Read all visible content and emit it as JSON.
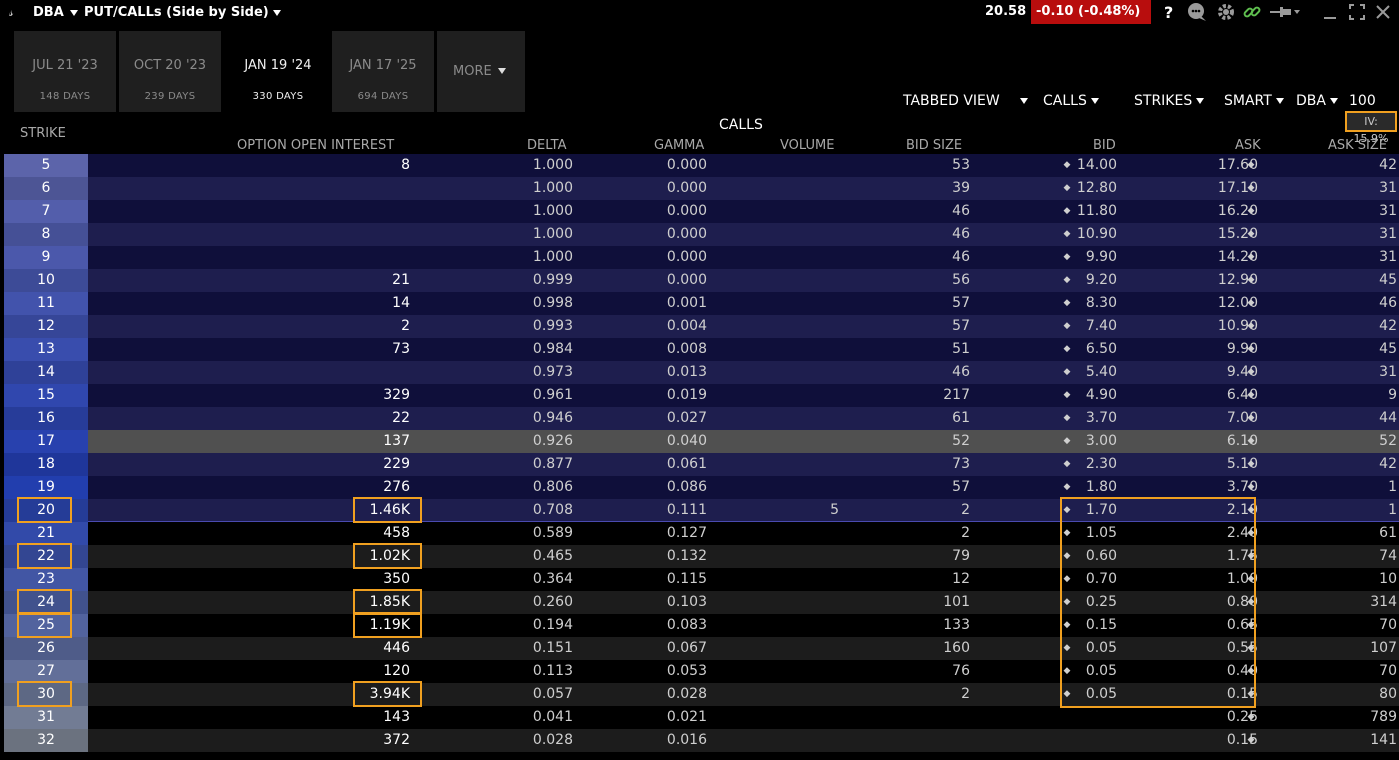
{
  "window": {
    "link_glyph": "𝓈",
    "symbol": "DBA",
    "layout_title": "PUT/CALLs (Side by Side)",
    "last_price": "20.58",
    "change": "-0.10 (-0.48%)",
    "icons": [
      "help-icon",
      "chat-icon",
      "gear-icon",
      "link-icon",
      "pin-icon",
      "minimize-icon",
      "maximize-icon",
      "close-icon"
    ]
  },
  "expiries": [
    {
      "date": "JUL 21 '23",
      "days": "148 DAYS",
      "active": false
    },
    {
      "date": "OCT 20 '23",
      "days": "239 DAYS",
      "active": false
    },
    {
      "date": "JAN 19 '24",
      "days": "330 DAYS",
      "active": true
    },
    {
      "date": "JAN 17 '25",
      "days": "694 DAYS",
      "active": false
    }
  ],
  "more_label": "MORE",
  "toolbar": {
    "tabbed_view": "TABBED VIEW",
    "calls": "CALLS",
    "strikes": "STRIKES",
    "smart": "SMART",
    "underlying": "DBA",
    "multiplier": "100"
  },
  "table_title": "CALLS",
  "iv_badge": "IV: 15.9%",
  "headers": {
    "strike": "STRIKE",
    "oi": "OPTION OPEN INTEREST",
    "delta": "DELTA",
    "gamma": "GAMMA",
    "volume": "VOLUME",
    "bid_size": "BID SIZE",
    "bid": "BID",
    "ask": "ASK",
    "ask_size": "ASK SIZE"
  },
  "rows": [
    {
      "strike": "5",
      "oi": "8",
      "delta": "1.000",
      "gamma": "0.000",
      "volume": "",
      "bid_size": "53",
      "bid": "14.00",
      "ask": "17.60",
      "ask_size": "42"
    },
    {
      "strike": "6",
      "oi": "",
      "delta": "1.000",
      "gamma": "0.000",
      "volume": "",
      "bid_size": "39",
      "bid": "12.80",
      "ask": "17.10",
      "ask_size": "31"
    },
    {
      "strike": "7",
      "oi": "",
      "delta": "1.000",
      "gamma": "0.000",
      "volume": "",
      "bid_size": "46",
      "bid": "11.80",
      "ask": "16.20",
      "ask_size": "31"
    },
    {
      "strike": "8",
      "oi": "",
      "delta": "1.000",
      "gamma": "0.000",
      "volume": "",
      "bid_size": "46",
      "bid": "10.90",
      "ask": "15.20",
      "ask_size": "31"
    },
    {
      "strike": "9",
      "oi": "",
      "delta": "1.000",
      "gamma": "0.000",
      "volume": "",
      "bid_size": "46",
      "bid": "9.90",
      "ask": "14.20",
      "ask_size": "31"
    },
    {
      "strike": "10",
      "oi": "21",
      "delta": "0.999",
      "gamma": "0.000",
      "volume": "",
      "bid_size": "56",
      "bid": "9.20",
      "ask": "12.90",
      "ask_size": "45"
    },
    {
      "strike": "11",
      "oi": "14",
      "delta": "0.998",
      "gamma": "0.001",
      "volume": "",
      "bid_size": "57",
      "bid": "8.30",
      "ask": "12.00",
      "ask_size": "46"
    },
    {
      "strike": "12",
      "oi": "2",
      "delta": "0.993",
      "gamma": "0.004",
      "volume": "",
      "bid_size": "57",
      "bid": "7.40",
      "ask": "10.90",
      "ask_size": "42"
    },
    {
      "strike": "13",
      "oi": "73",
      "delta": "0.984",
      "gamma": "0.008",
      "volume": "",
      "bid_size": "51",
      "bid": "6.50",
      "ask": "9.90",
      "ask_size": "45"
    },
    {
      "strike": "14",
      "oi": "",
      "delta": "0.973",
      "gamma": "0.013",
      "volume": "",
      "bid_size": "46",
      "bid": "5.40",
      "ask": "9.40",
      "ask_size": "31"
    },
    {
      "strike": "15",
      "oi": "329",
      "delta": "0.961",
      "gamma": "0.019",
      "volume": "",
      "bid_size": "217",
      "bid": "4.90",
      "ask": "6.40",
      "ask_size": "9"
    },
    {
      "strike": "16",
      "oi": "22",
      "delta": "0.946",
      "gamma": "0.027",
      "volume": "",
      "bid_size": "61",
      "bid": "3.70",
      "ask": "7.00",
      "ask_size": "44"
    },
    {
      "strike": "17",
      "oi": "137",
      "delta": "0.926",
      "gamma": "0.040",
      "volume": "",
      "bid_size": "52",
      "bid": "3.00",
      "ask": "6.10",
      "ask_size": "52"
    },
    {
      "strike": "18",
      "oi": "229",
      "delta": "0.877",
      "gamma": "0.061",
      "volume": "",
      "bid_size": "73",
      "bid": "2.30",
      "ask": "5.10",
      "ask_size": "42"
    },
    {
      "strike": "19",
      "oi": "276",
      "delta": "0.806",
      "gamma": "0.086",
      "volume": "",
      "bid_size": "57",
      "bid": "1.80",
      "ask": "3.70",
      "ask_size": "1"
    },
    {
      "strike": "20",
      "oi": "1.46K",
      "delta": "0.708",
      "gamma": "0.111",
      "volume": "5",
      "bid_size": "2",
      "bid": "1.70",
      "ask": "2.10",
      "ask_size": "1"
    },
    {
      "strike": "21",
      "oi": "458",
      "delta": "0.589",
      "gamma": "0.127",
      "volume": "",
      "bid_size": "2",
      "bid": "1.05",
      "ask": "2.40",
      "ask_size": "61"
    },
    {
      "strike": "22",
      "oi": "1.02K",
      "delta": "0.465",
      "gamma": "0.132",
      "volume": "",
      "bid_size": "79",
      "bid": "0.60",
      "ask": "1.75",
      "ask_size": "74"
    },
    {
      "strike": "23",
      "oi": "350",
      "delta": "0.364",
      "gamma": "0.115",
      "volume": "",
      "bid_size": "12",
      "bid": "0.70",
      "ask": "1.00",
      "ask_size": "10"
    },
    {
      "strike": "24",
      "oi": "1.85K",
      "delta": "0.260",
      "gamma": "0.103",
      "volume": "",
      "bid_size": "101",
      "bid": "0.25",
      "ask": "0.80",
      "ask_size": "314"
    },
    {
      "strike": "25",
      "oi": "1.19K",
      "delta": "0.194",
      "gamma": "0.083",
      "volume": "",
      "bid_size": "133",
      "bid": "0.15",
      "ask": "0.65",
      "ask_size": "70"
    },
    {
      "strike": "26",
      "oi": "446",
      "delta": "0.151",
      "gamma": "0.067",
      "volume": "",
      "bid_size": "160",
      "bid": "0.05",
      "ask": "0.55",
      "ask_size": "107"
    },
    {
      "strike": "27",
      "oi": "120",
      "delta": "0.113",
      "gamma": "0.053",
      "volume": "",
      "bid_size": "76",
      "bid": "0.05",
      "ask": "0.40",
      "ask_size": "70"
    },
    {
      "strike": "30",
      "oi": "3.94K",
      "delta": "0.057",
      "gamma": "0.028",
      "volume": "",
      "bid_size": "2",
      "bid": "0.05",
      "ask": "0.15",
      "ask_size": "80"
    },
    {
      "strike": "31",
      "oi": "143",
      "delta": "0.041",
      "gamma": "0.021",
      "volume": "",
      "bid_size": "",
      "bid": "",
      "ask": "0.25",
      "ask_size": "789"
    },
    {
      "strike": "32",
      "oi": "372",
      "delta": "0.028",
      "gamma": "0.016",
      "volume": "",
      "bid_size": "",
      "bid": "",
      "ask": "0.15",
      "ask_size": "141"
    }
  ],
  "colors": {
    "itm_row_dark": "#0f0f3a",
    "itm_row_light": "#1e1e4e",
    "otm_row_dark": "#000000",
    "otm_row_light": "#1c1c1c",
    "atm_row": "#505050",
    "change_bg": "#b80d0d",
    "highlight": "#f0a020"
  }
}
